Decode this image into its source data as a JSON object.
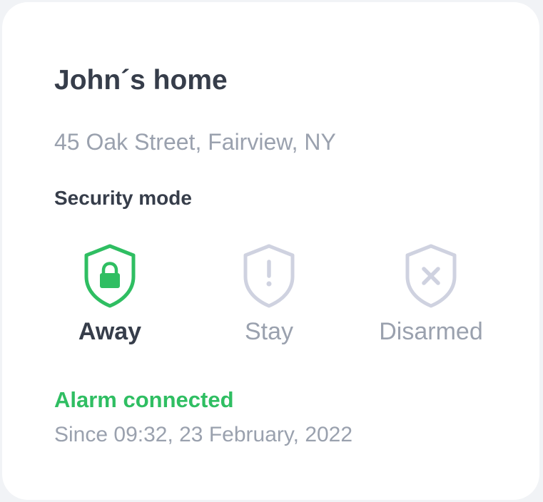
{
  "home": {
    "title": "John´s home",
    "address": "45 Oak Street, Fairview, NY"
  },
  "security": {
    "label": "Security mode",
    "modes": [
      {
        "label": "Away",
        "icon": "shield-lock-icon",
        "selected": true
      },
      {
        "label": "Stay",
        "icon": "shield-exclamation-icon",
        "selected": false
      },
      {
        "label": "Disarmed",
        "icon": "shield-x-icon",
        "selected": false
      }
    ]
  },
  "status": {
    "title": "Alarm connected",
    "since": "Since 09:32, 23 February, 2022"
  },
  "colors": {
    "accent_green": "#2fbe62",
    "text_dark": "#363d4a",
    "text_muted": "#9aa1ae",
    "icon_inactive": "#cfd2e0"
  }
}
